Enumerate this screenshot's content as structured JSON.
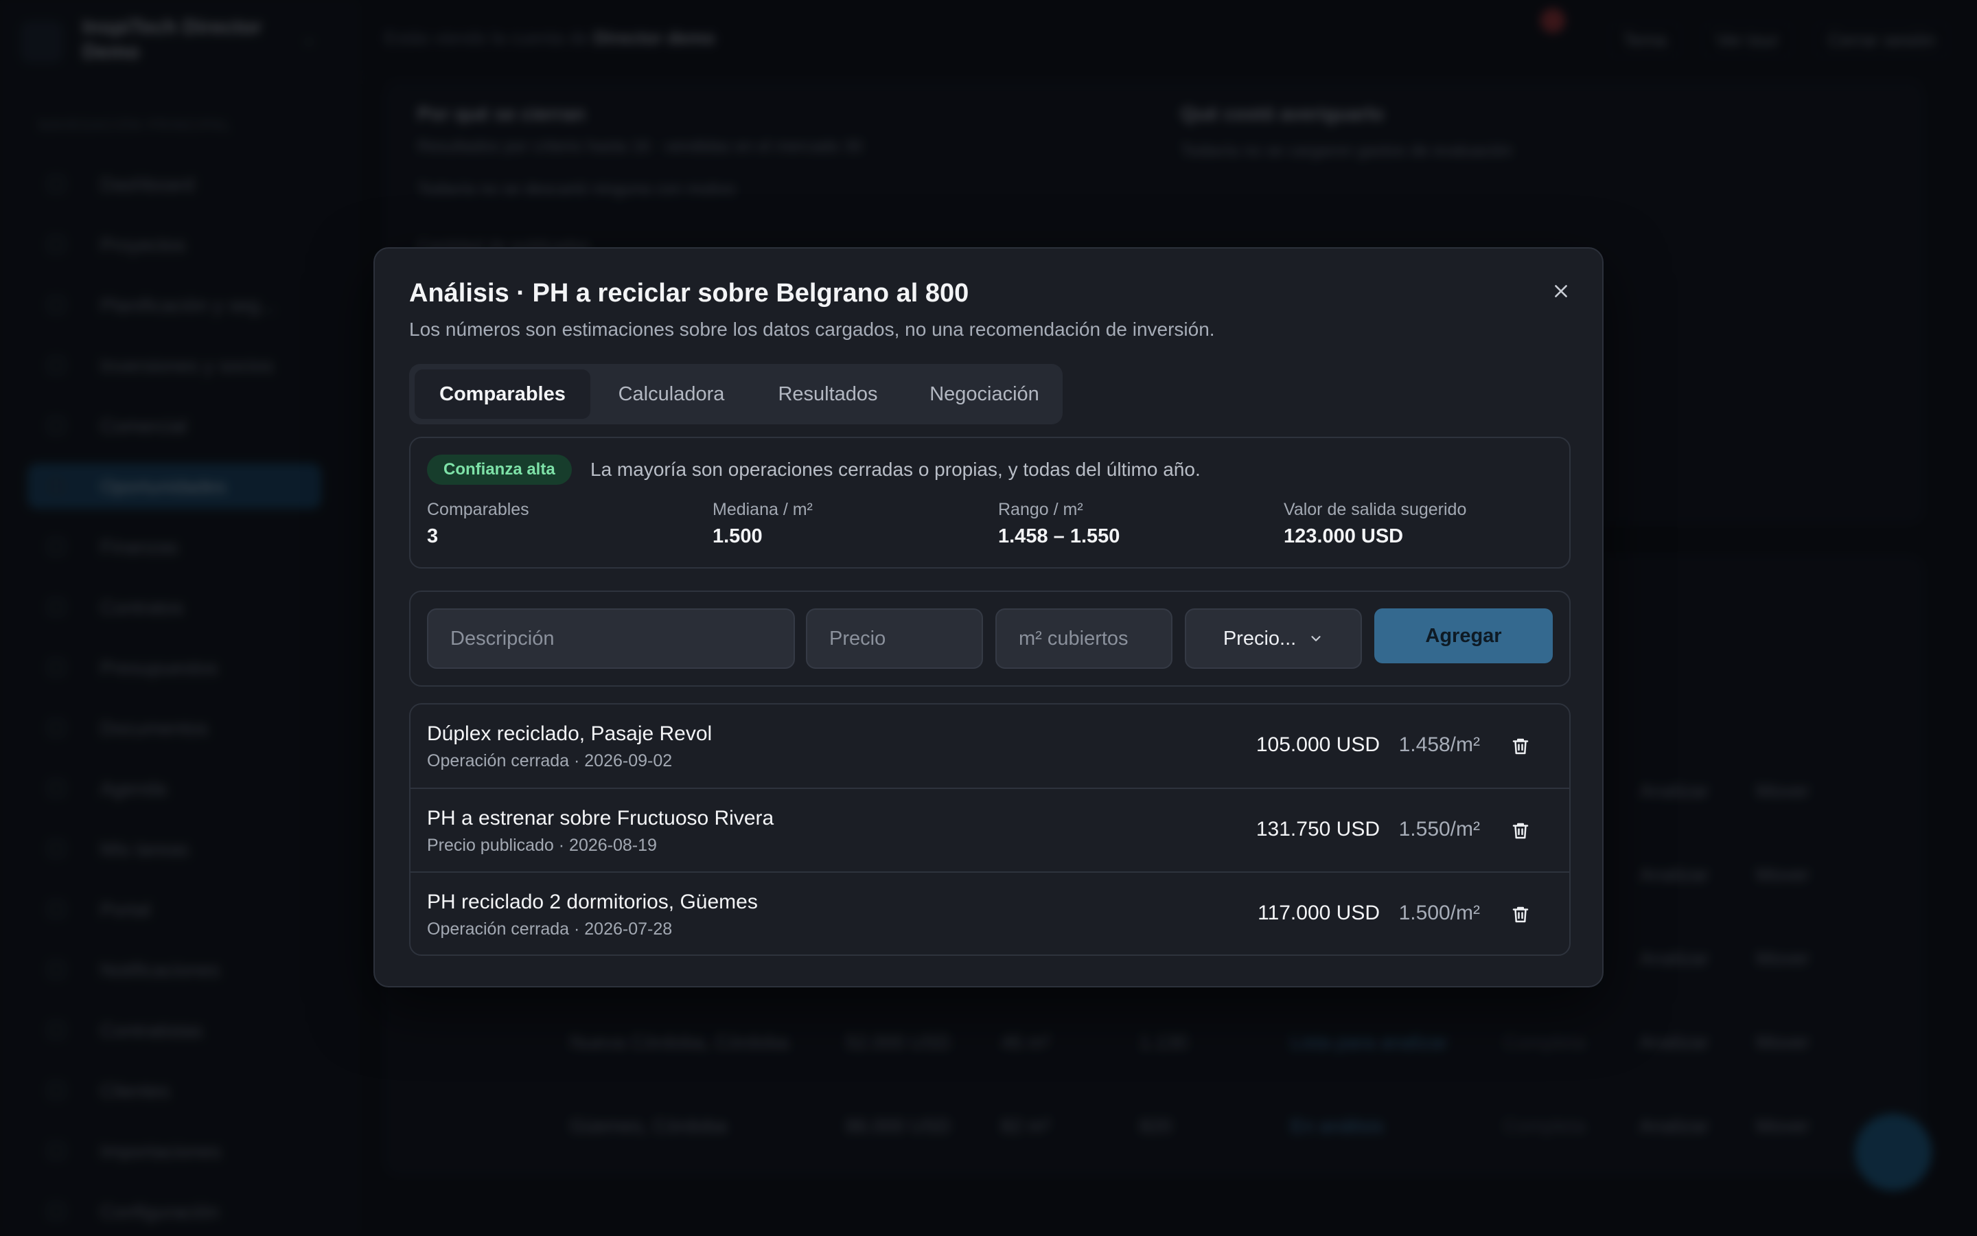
{
  "background": {
    "brand": "InspiTech Director Demo",
    "section_label": "NAVEGACIÓN PRINCIPAL",
    "sidebar": [
      "Dashboard",
      "Proyectos",
      "Planificación y seg...",
      "Inversiones y socios",
      "Comercial",
      "Oportunidades",
      "Finanzas",
      "Contratos",
      "Presupuestos",
      "Documentos",
      "Agenda",
      "Mis tareas",
      "Portal",
      "Notificaciones",
      "Contratistas",
      "Clientes",
      "Importaciones",
      "Configuración"
    ],
    "breadcrumb_prefix": "Estás viendo la cuenta de",
    "breadcrumb_name": "Director demo",
    "top_actions": [
      "Tema",
      "Ver tour",
      "Cerrar sesión"
    ],
    "card_left_title": "Por qué se cierran",
    "card_left_line1": "Resultados por criterio hasta 16 · vendidas en el mercado 30",
    "card_left_line2": "Todavía no se descartó ninguna con motivo",
    "card_left_line3": "Cantidad de publicados",
    "card_right_title": "Qué costó averiguarlo",
    "card_right_line1": "Todavía no se cargaron gastos de evaluación",
    "table_rows": [
      {
        "c1": "...",
        "c2": "Analizar",
        "c3": "Mover"
      },
      {
        "c1": "...",
        "c2": "Analizar",
        "c3": "Mover"
      },
      {
        "c1": "...",
        "c2": "Analizar",
        "c3": "Mover"
      },
      {
        "c1": "Nueva Córdoba, Córdoba",
        "c2": "52.000 USD",
        "c3": "46 m²",
        "c4": "1.130",
        "c5": "Lista para analizar",
        "c6": "Completa",
        "c7": "Analizar",
        "c8": "Mover"
      },
      {
        "c1": "Güemes, Córdoba",
        "c2": "86.000 USD",
        "c3": "82 m²",
        "c4": "820",
        "c5": "En análisis",
        "c6": "Completa",
        "c7": "Analizar",
        "c8": "Mover"
      }
    ]
  },
  "modal": {
    "title": "Análisis · PH a reciclar sobre Belgrano al 800",
    "subtitle": "Los números son estimaciones sobre los datos cargados, no una recomendación de inversión.",
    "tabs": [
      {
        "label": "Comparables",
        "active": true
      },
      {
        "label": "Calculadora",
        "active": false
      },
      {
        "label": "Resultados",
        "active": false
      },
      {
        "label": "Negociación",
        "active": false
      }
    ],
    "confidence": {
      "badge": "Confianza alta",
      "badge_color": "#7ee2a8",
      "description": "La mayoría son operaciones cerradas o propias, y todas del último año."
    },
    "stats": [
      {
        "label": "Comparables",
        "value": "3"
      },
      {
        "label": "Mediana / m²",
        "value": "1.500"
      },
      {
        "label": "Rango / m²",
        "value": "1.458 – 1.550"
      },
      {
        "label": "Valor de salida sugerido",
        "value": "123.000 USD"
      }
    ],
    "form": {
      "description_placeholder": "Descripción",
      "price_placeholder": "Precio",
      "area_placeholder": "m² cubiertos",
      "type_select": "Precio...",
      "add_button": "Agregar"
    },
    "comparables": [
      {
        "title": "Dúplex reciclado, Pasaje Revol",
        "meta": "Operación cerrada · 2026-09-02",
        "price": "105.000 USD",
        "per_m2": "1.458/m²"
      },
      {
        "title": "PH a estrenar sobre Fructuoso Rivera",
        "meta": "Precio publicado · 2026-08-19",
        "price": "131.750 USD",
        "per_m2": "1.550/m²"
      },
      {
        "title": "PH reciclado 2 dormitorios, Güemes",
        "meta": "Operación cerrada · 2026-07-28",
        "price": "117.000 USD",
        "per_m2": "1.500/m²"
      }
    ],
    "accent_color": "#34698f"
  }
}
